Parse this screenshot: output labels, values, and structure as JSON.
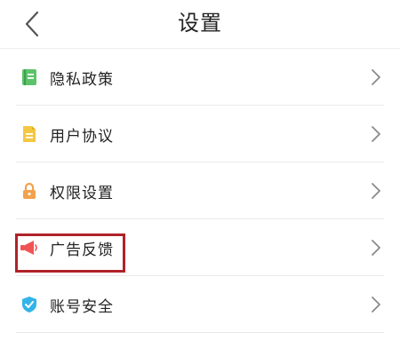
{
  "header": {
    "title": "设置",
    "back_icon": "chevron-left-icon"
  },
  "settings": {
    "items": [
      {
        "label": "隐私政策",
        "icon": "notebook-icon",
        "icon_color": "#5cc36a"
      },
      {
        "label": "用户协议",
        "icon": "document-icon",
        "icon_color": "#f5c842"
      },
      {
        "label": "权限设置",
        "icon": "lock-icon",
        "icon_color": "#f3a14b"
      },
      {
        "label": "广告反馈",
        "icon": "megaphone-icon",
        "icon_color": "#f05454"
      },
      {
        "label": "账号安全",
        "icon": "shield-check-icon",
        "icon_color": "#34b4e8"
      }
    ]
  },
  "colors": {
    "highlight_border": "#b0232a",
    "chevron": "#8a8a8a",
    "text": "#222222"
  }
}
